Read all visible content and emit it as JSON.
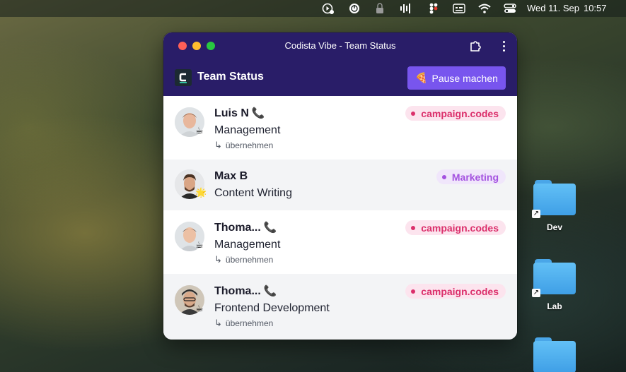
{
  "menubar": {
    "icons": [
      "screen-record-icon",
      "power-icon",
      "lock-battery-icon",
      "audio-waves-icon",
      "figma-icon",
      "keyboard-icon",
      "wifi-icon",
      "control-center-icon"
    ],
    "date": "Wed 11. Sep",
    "time": "10:57"
  },
  "window": {
    "title": "Codista Vibe - Team Status",
    "app_name": "Team Status",
    "pause_button": "Pause machen"
  },
  "team": [
    {
      "name": "Luis N",
      "dept": "Management",
      "tag": "campaign.codes",
      "tag_color": "#db2f6b",
      "take": "übernehmen",
      "status_emoji": "☕",
      "on_call": true
    },
    {
      "name": "Max B",
      "dept": "Content Writing",
      "tag": "Marketing",
      "tag_color": "#a452e0",
      "take": "",
      "status_emoji": "🌟",
      "on_call": false
    },
    {
      "name": "Thoma...",
      "dept": "Management",
      "tag": "campaign.codes",
      "tag_color": "#db2f6b",
      "take": "übernehmen",
      "status_emoji": "☕",
      "on_call": true
    },
    {
      "name": "Thoma...",
      "dept": "Frontend Development",
      "tag": "campaign.codes",
      "tag_color": "#db2f6b",
      "take": "übernehmen",
      "status_emoji": "☕",
      "on_call": true
    }
  ],
  "desktop": {
    "folders": [
      "Dev",
      "Lab",
      ""
    ]
  }
}
